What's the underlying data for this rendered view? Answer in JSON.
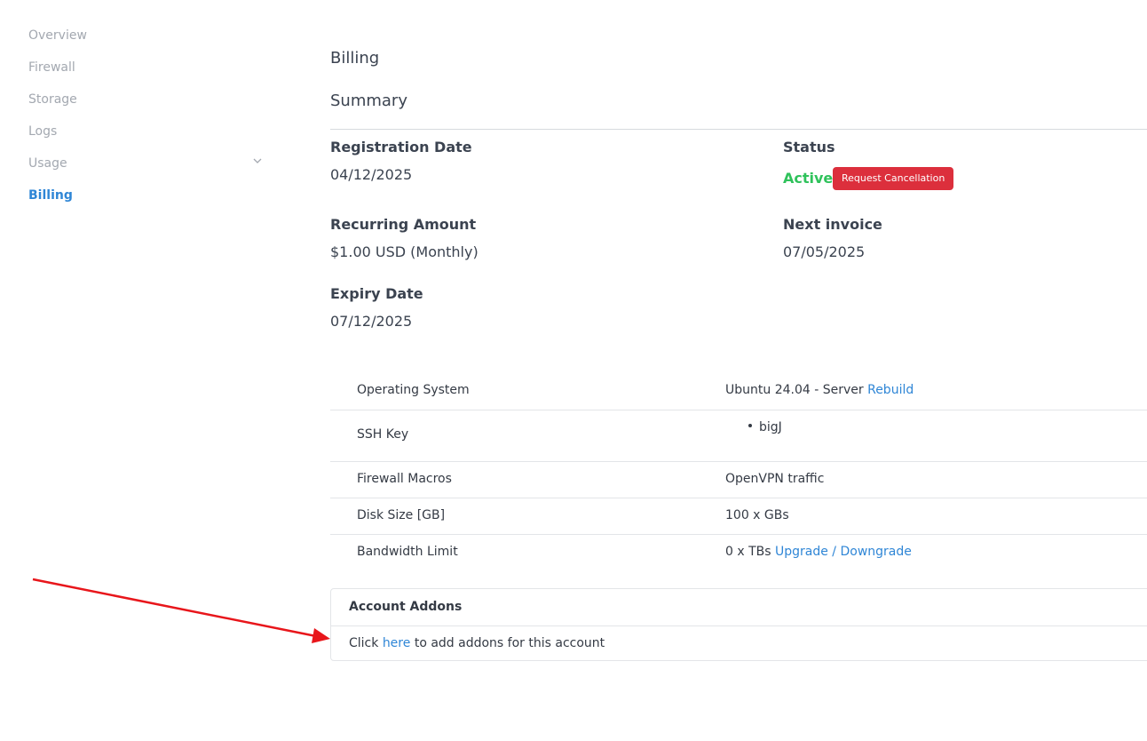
{
  "sidebar": {
    "items": [
      {
        "label": "Overview",
        "active": false
      },
      {
        "label": "Firewall",
        "active": false
      },
      {
        "label": "Storage",
        "active": false
      },
      {
        "label": "Logs",
        "active": false
      },
      {
        "label": "Usage",
        "active": false,
        "icon": "chevron-down-icon"
      },
      {
        "label": "Billing",
        "active": true
      }
    ]
  },
  "main": {
    "section_title": "Billing",
    "summary_title": "Summary",
    "registration_date": {
      "label": "Registration Date",
      "value": "04/12/2025"
    },
    "status": {
      "label": "Status",
      "value": "Active",
      "cancel_button": "Request Cancellation"
    },
    "recurring_amount": {
      "label": "Recurring Amount",
      "value": "$1.00 USD (Monthly)"
    },
    "next_invoice": {
      "label": "Next invoice",
      "value": "07/05/2025"
    },
    "expiry_date": {
      "label": "Expiry Date",
      "value": "07/12/2025"
    }
  },
  "details": {
    "rows": [
      {
        "label": "Operating System",
        "value": "Ubuntu 24.04 - Server",
        "link": "Rebuild"
      },
      {
        "label": "SSH Key",
        "list": [
          "bigJ"
        ]
      },
      {
        "label": "Firewall Macros",
        "value": "OpenVPN traffic"
      },
      {
        "label": "Disk Size [GB]",
        "value": "100 x GBs"
      },
      {
        "label": "Bandwidth Limit",
        "value": "0 x TBs",
        "link": "Upgrade / Downgrade"
      }
    ]
  },
  "addons": {
    "title": "Account Addons",
    "text_before": "Click",
    "link": "here",
    "text_after": "to add addons for this account"
  },
  "colors": {
    "accent": "#2f86d6",
    "active_status": "#2fc25b",
    "danger": "#dc2f3c",
    "annotation_arrow": "#e8161b"
  }
}
